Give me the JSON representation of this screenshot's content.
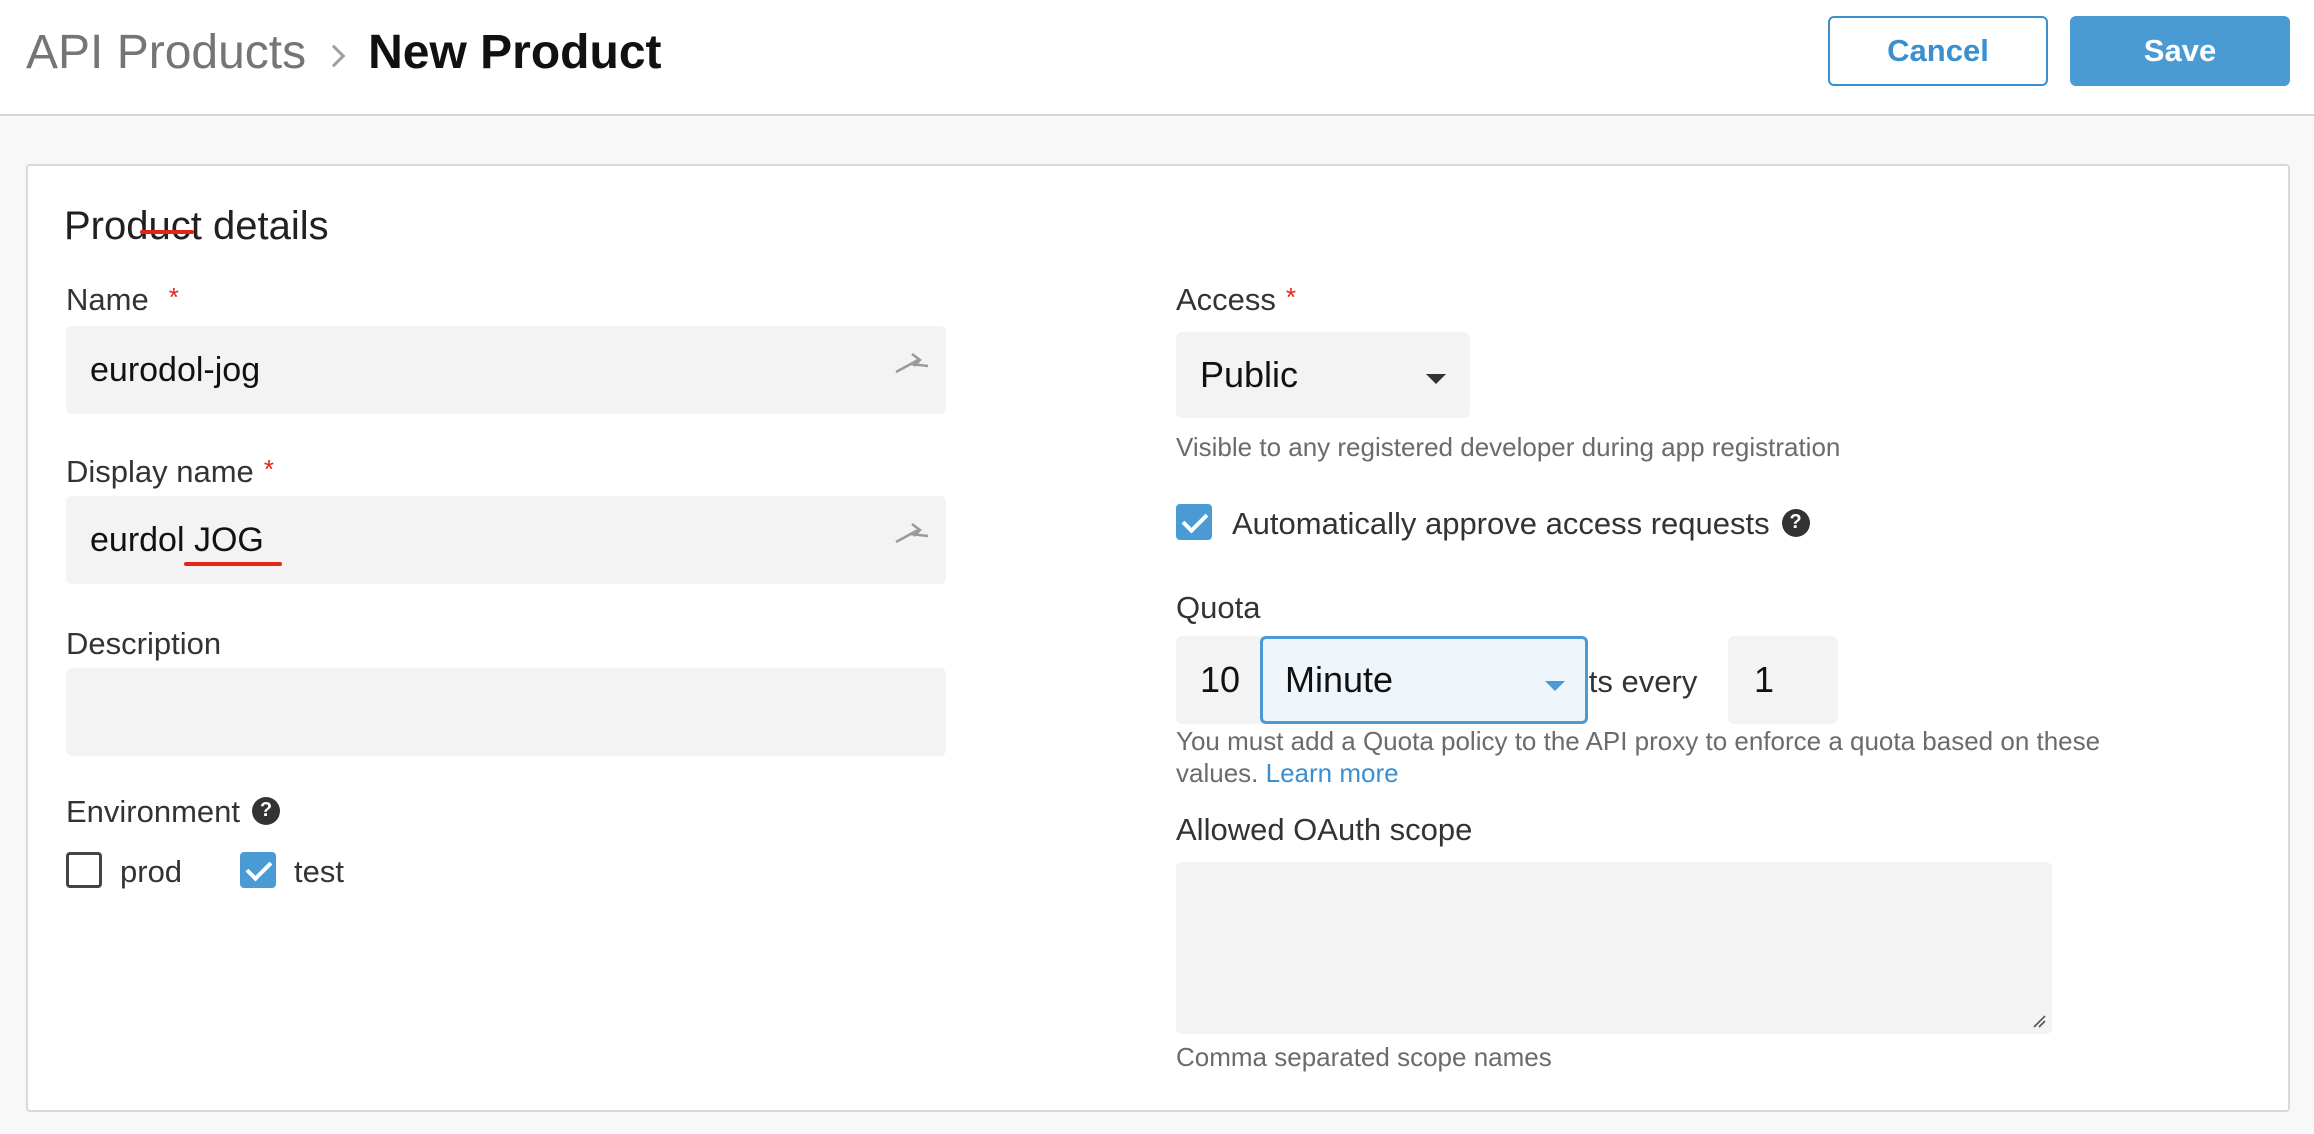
{
  "header": {
    "breadcrumb_root": "API Products",
    "breadcrumb_current": "New Product",
    "cancel_label": "Cancel",
    "save_label": "Save"
  },
  "card": {
    "title": "Product details"
  },
  "left": {
    "name_label": "Name",
    "name_value": "eurodol-jog",
    "display_name_label": "Display name",
    "display_name_value": "eurdol JOG",
    "description_label": "Description",
    "description_value": "",
    "environment_label": "Environment",
    "environments": [
      {
        "label": "prod",
        "checked": false
      },
      {
        "label": "test",
        "checked": true
      }
    ]
  },
  "right": {
    "access_label": "Access",
    "access_value": "Public",
    "access_hint": "Visible to any registered developer during app registration",
    "auto_approve_label": "Automatically approve access requests",
    "auto_approve_checked": true,
    "quota_label": "Quota",
    "quota_requests": "10",
    "quota_requests_every": "requests every",
    "quota_interval": "1",
    "quota_unit": "Minute",
    "quota_hint_line1": "You must add a Quota policy to the API proxy to enforce a quota based on these",
    "quota_hint_line2": "values.",
    "learn_more": "Learn more",
    "oauth_label": "Allowed OAuth scope",
    "oauth_value": "",
    "oauth_hint": "Comma separated scope names"
  },
  "required_marker": "*",
  "help_glyph": "?",
  "colors": {
    "accent": "#4a9ad4",
    "required": "#e0251b",
    "link": "#3a8fcf"
  }
}
